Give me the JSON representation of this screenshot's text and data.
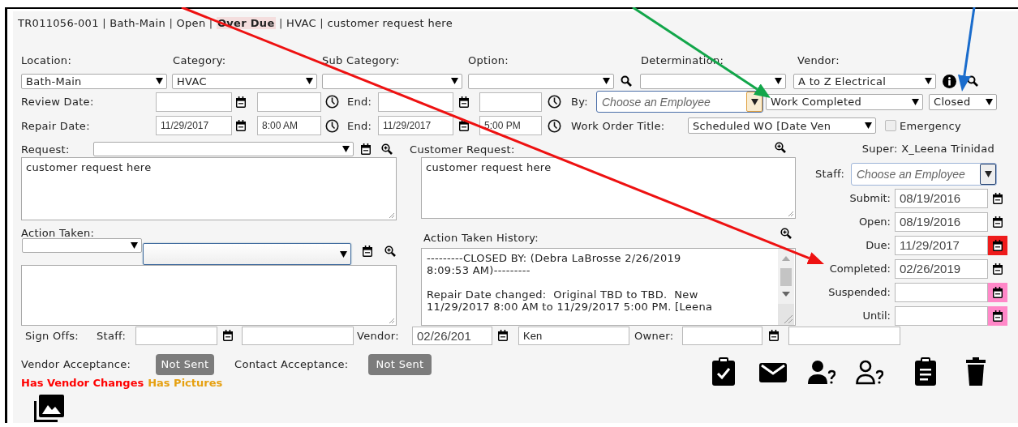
{
  "header": [
    {
      "text": "TR011056-001",
      "kind": "plain"
    },
    {
      "text": "|",
      "kind": "separator"
    },
    {
      "text": "Bath-Main",
      "kind": "plain"
    },
    {
      "text": "|",
      "kind": "separator"
    },
    {
      "text": "Open",
      "kind": "plain"
    },
    {
      "text": "|",
      "kind": "separator"
    },
    {
      "text": "Over Due",
      "kind": "alert"
    },
    {
      "text": "|",
      "kind": "separator"
    },
    {
      "text": "HVAC",
      "kind": "plain"
    },
    {
      "text": "|",
      "kind": "separator"
    },
    {
      "text": "customer request here",
      "kind": "plain"
    }
  ],
  "classification": [
    {
      "label": "Location:",
      "value": "Bath-Main"
    },
    {
      "label": "Category:",
      "value": "HVAC"
    },
    {
      "label": "Sub Category:"
    },
    {
      "label": "Option:"
    },
    {
      "label": "Determination:"
    },
    {
      "label": "Vendor:",
      "value": "A to Z Electrical"
    }
  ],
  "review_date": {
    "label": "Review Date:",
    "end_label": "End:",
    "by_label": "By:",
    "by_placeholder": "Choose an Employee",
    "by_focused": true,
    "status": "Work Completed",
    "state": "Closed"
  },
  "repair_date": {
    "label": "Repair Date:",
    "start_date": "11/29/2017",
    "start_time": "8:00 AM",
    "end_label": "End:",
    "end_date": "11/29/2017",
    "end_time": "5:00 PM",
    "title_label": "Work Order Title:",
    "title": "Scheduled WO [Date Ven",
    "emergency_label": "Emergency",
    "emergency": false
  },
  "request": {
    "label": "Request:",
    "text": "customer request here"
  },
  "action_taken": {
    "label": "Action Taken:",
    "focused": true
  },
  "customer_request": {
    "label": "Customer Request:",
    "text": "customer request here"
  },
  "history": {
    "label": "Action Taken History:",
    "paragraphs": [
      "---------CLOSED BY: (Debra LaBrosse 2/26/2019\n8:09:53 AM)---------",
      "Repair Date changed:  Original TBD to TBD.  New\n11/29/2017 8:00 AM to 11/29/2017 5:00 PM. [Leena"
    ]
  },
  "super": "Super: X_Leena Trinidad",
  "staff": {
    "label": "Staff:",
    "placeholder": "Choose an Employee",
    "focused": false
  },
  "dates": [
    {
      "label": "Submit:",
      "value": "08/19/2016"
    },
    {
      "label": "Open:",
      "value": "08/19/2016"
    },
    {
      "label": "Due:",
      "value": "11/29/2017",
      "color": "#ee1c1c"
    },
    {
      "label": "Completed:",
      "value": "02/26/2019"
    },
    {
      "label": "Suspended:",
      "color": "#ff88c8"
    },
    {
      "label": "Until:",
      "color": "#ff88c8"
    }
  ],
  "sign_offs": {
    "label": "Sign Offs:",
    "staff_label": "Staff:",
    "vendor_label": "Vendor:",
    "vendor_date": "02/26/201",
    "vendor_name": "Ken",
    "owner_label": "Owner:"
  },
  "acceptance": [
    {
      "label": "Vendor Acceptance:",
      "status": "Not Sent"
    },
    {
      "label": "Contact Acceptance:",
      "status": "Not Sent"
    }
  ],
  "flags": [
    {
      "text": "Has Vendor Changes",
      "color": "#ff0000"
    },
    {
      "text": "Has Pictures",
      "color": "#e6a010"
    }
  ],
  "annotations": [
    {
      "color": "#ee1111"
    },
    {
      "color": "#12a64a"
    },
    {
      "color": "#1a6ccc"
    }
  ]
}
